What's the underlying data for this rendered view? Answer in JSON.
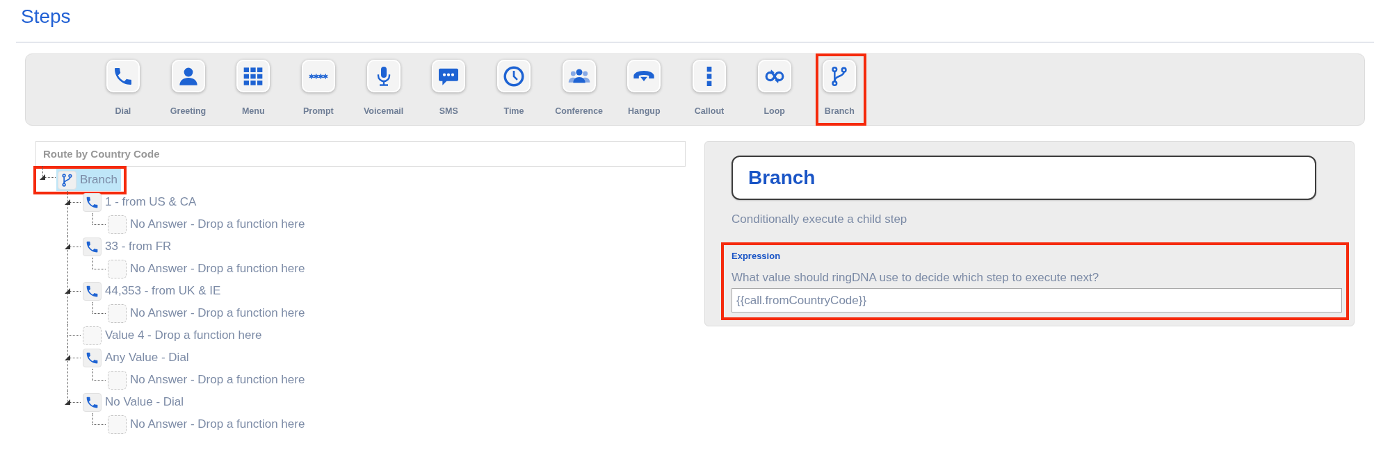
{
  "page": {
    "title": "Steps"
  },
  "toolbar": {
    "items": [
      {
        "kind": "dial",
        "label": "Dial",
        "highlighted": false
      },
      {
        "kind": "greeting",
        "label": "Greeting",
        "highlighted": false
      },
      {
        "kind": "menu",
        "label": "Menu",
        "highlighted": false
      },
      {
        "kind": "prompt",
        "label": "Prompt",
        "highlighted": false
      },
      {
        "kind": "voicemail",
        "label": "Voicemail",
        "highlighted": false
      },
      {
        "kind": "sms",
        "label": "SMS",
        "highlighted": false
      },
      {
        "kind": "time",
        "label": "Time",
        "highlighted": false
      },
      {
        "kind": "conference",
        "label": "Conference",
        "highlighted": false
      },
      {
        "kind": "hangup",
        "label": "Hangup",
        "highlighted": false
      },
      {
        "kind": "callout",
        "label": "Callout",
        "highlighted": false
      },
      {
        "kind": "loop",
        "label": "Loop",
        "highlighted": false
      },
      {
        "kind": "branch",
        "label": "Branch",
        "highlighted": true
      }
    ]
  },
  "tree": {
    "header": "Route by Country Code",
    "nodes": [
      {
        "kind": "branch",
        "label": "Branch",
        "selected": true,
        "highlighted": true,
        "expanded": true,
        "children": [
          {
            "kind": "dial",
            "label": "1 - from US & CA",
            "selected": false,
            "expanded": true,
            "children": [
              {
                "kind": "empty",
                "label": "No Answer - Drop a function here",
                "selected": false
              }
            ]
          },
          {
            "kind": "dial",
            "label": "33 - from FR",
            "selected": false,
            "expanded": true,
            "children": [
              {
                "kind": "empty",
                "label": "No Answer - Drop a function here",
                "selected": false
              }
            ]
          },
          {
            "kind": "dial",
            "label": "44,353 - from UK & IE",
            "selected": false,
            "expanded": true,
            "children": [
              {
                "kind": "empty",
                "label": "No Answer - Drop a function here",
                "selected": false
              }
            ]
          },
          {
            "kind": "empty",
            "label": "Value 4 - Drop a function here",
            "selected": false
          },
          {
            "kind": "dial",
            "label": "Any Value - Dial",
            "selected": false,
            "expanded": true,
            "children": [
              {
                "kind": "empty",
                "label": "No Answer - Drop a function here",
                "selected": false
              }
            ]
          },
          {
            "kind": "dial",
            "label": "No Value - Dial",
            "selected": false,
            "expanded": true,
            "children": [
              {
                "kind": "empty",
                "label": "No Answer - Drop a function here",
                "selected": false
              }
            ]
          }
        ]
      }
    ]
  },
  "details": {
    "title": "Branch",
    "description": "Conditionally execute a child step",
    "expression": {
      "label": "Expression",
      "question": "What value should ringDNA use to decide which step to execute next?",
      "value": "{{call.fromCountryCode}}",
      "highlighted": true
    }
  }
}
